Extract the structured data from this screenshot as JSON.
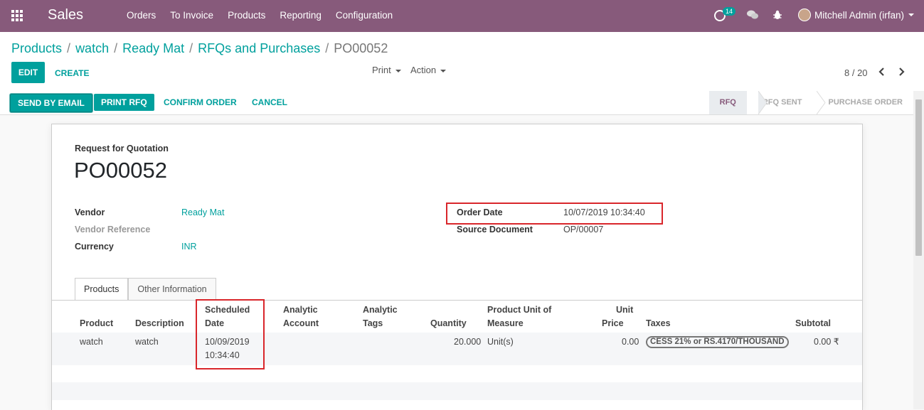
{
  "navbar": {
    "app_name": "Sales",
    "menu": [
      "Orders",
      "To Invoice",
      "Products",
      "Reporting",
      "Configuration"
    ],
    "activity_count": "14",
    "user_name": "Mitchell Admin (irfan)",
    "color": "#875a7b"
  },
  "breadcrumb": {
    "items": [
      "Products",
      "watch",
      "Ready Mat",
      "RFQs and Purchases"
    ],
    "current": "PO00052"
  },
  "control": {
    "edit_label": "EDIT",
    "create_label": "CREATE",
    "print_label": "Print",
    "action_label": "Action",
    "pager": "8 / 20"
  },
  "statusbar": {
    "buttons": [
      "SEND BY EMAIL",
      "PRINT RFQ",
      "CONFIRM ORDER",
      "CANCEL"
    ],
    "stages": [
      "RFQ",
      "RFQ SENT",
      "PURCHASE ORDER"
    ],
    "active_stage": "RFQ"
  },
  "form": {
    "doc_type": "Request for Quotation",
    "name": "PO00052",
    "vendor_label": "Vendor",
    "vendor_value": "Ready Mat",
    "vendor_ref_label": "Vendor Reference",
    "currency_label": "Currency",
    "currency_value": "INR",
    "order_date_label": "Order Date",
    "order_date_value": "10/07/2019 10:34:40",
    "source_doc_label": "Source Document",
    "source_doc_value": "OP/00007"
  },
  "tabs": [
    "Products",
    "Other Information"
  ],
  "lines": {
    "headers": {
      "product": "Product",
      "description": "Description",
      "scheduled_1": "Scheduled",
      "scheduled_2": "Date",
      "analytic_account_1": "Analytic",
      "analytic_account_2": "Account",
      "analytic_tags_1": "Analytic",
      "analytic_tags_2": "Tags",
      "quantity": "Quantity",
      "uom_1": "Product Unit of",
      "uom_2": "Measure",
      "unit_price_1": "Unit",
      "unit_price_2": "Price",
      "taxes": "Taxes",
      "subtotal": "Subtotal"
    },
    "rows": [
      {
        "product": "watch",
        "description": "watch",
        "scheduled_date_1": "10/09/2019",
        "scheduled_date_2": "10:34:40",
        "quantity": "20.000",
        "uom": "Unit(s)",
        "unit_price": "0.00",
        "tax": "CESS 21% or RS.4170/THOUSAND",
        "subtotal": "0.00 ₹"
      }
    ]
  },
  "colors": {
    "primary": "#00a09d",
    "highlight": "#d9262b"
  }
}
